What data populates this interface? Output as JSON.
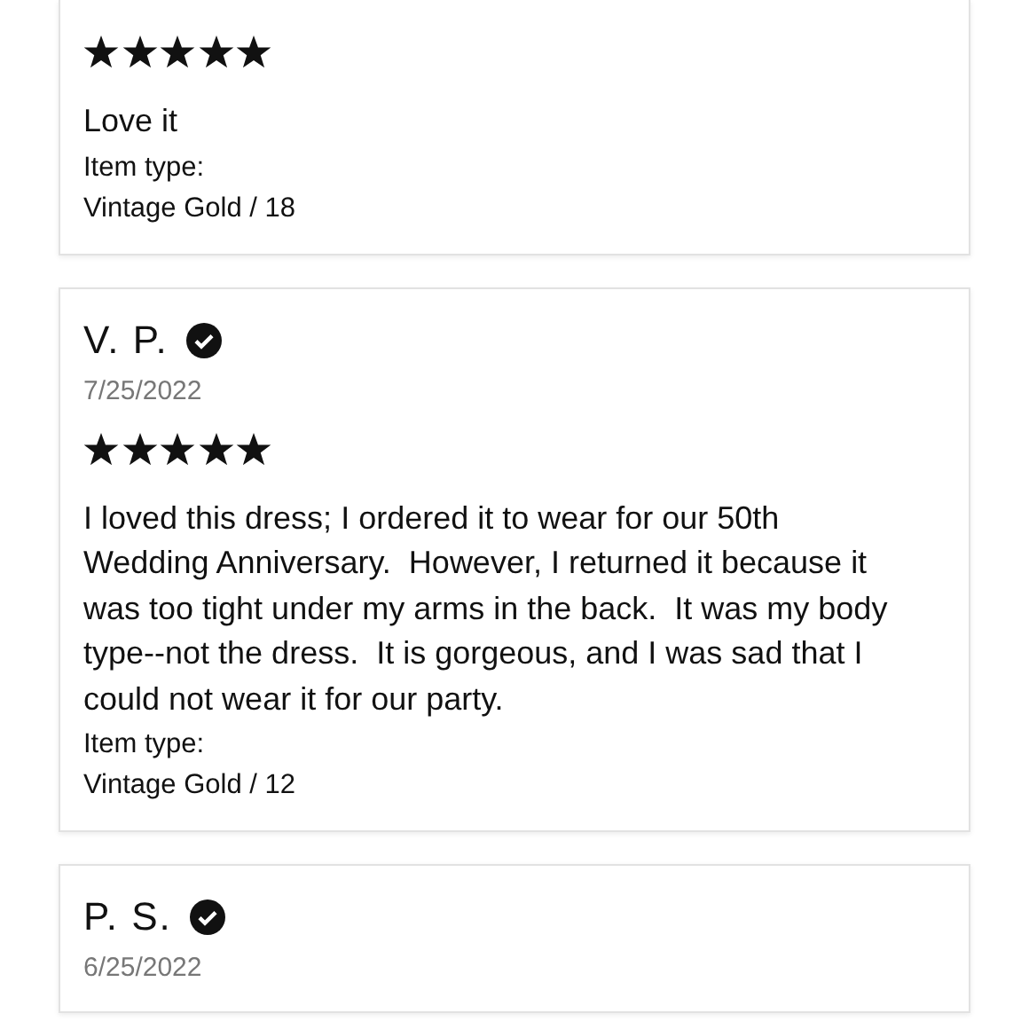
{
  "reviews": [
    {
      "stars": 5,
      "text": "Love it",
      "item_type_label": "Item type:",
      "item_type_value": "Vintage Gold / 18"
    },
    {
      "name": "V. P.",
      "verified": true,
      "date": "7/25/2022",
      "stars": 5,
      "text": "I loved this dress; I ordered it to wear for our 50th Wedding Anniversary.  However, I returned it because it was too tight under my arms in the back.  It was my body type--not the dress.  It is gorgeous, and I was sad that I could not wear it for our party.",
      "item_type_label": "Item type:",
      "item_type_value": "Vintage Gold / 12"
    },
    {
      "name": "P. S.",
      "verified": true,
      "date": "6/25/2022"
    }
  ]
}
